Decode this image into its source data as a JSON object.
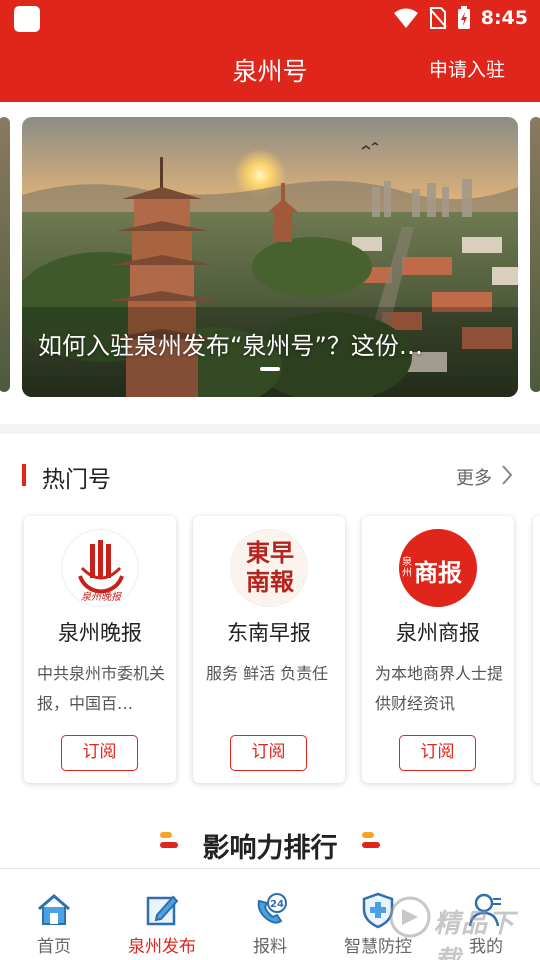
{
  "status_bar": {
    "time": "8:45"
  },
  "header": {
    "title": "泉州号",
    "apply_label": "申请入驻"
  },
  "banner": {
    "caption": "如何入驻泉州发布“泉州号”？这份…"
  },
  "hot_section": {
    "title": "热门号",
    "more_label": "更多",
    "cards": [
      {
        "name": "泉州晚报",
        "logo_text": "泉州晚报",
        "desc": "中共泉州市委机关报，中国百…",
        "subscribe_label": "订阅"
      },
      {
        "name": "东南早报",
        "logo_text": "東早南報",
        "desc": "服务 鲜活 负责任",
        "subscribe_label": "订阅"
      },
      {
        "name": "泉州商报",
        "logo_text_small": "泉州",
        "logo_text": "商报",
        "desc": "为本地商界人士提供财经资讯",
        "subscribe_label": "订阅"
      }
    ]
  },
  "ranking": {
    "title": "影响力排行"
  },
  "tabbar": {
    "tabs": [
      {
        "label": "首页",
        "icon": "home-icon"
      },
      {
        "label": "泉州发布",
        "icon": "edit-icon"
      },
      {
        "label": "报料",
        "icon": "phone-24-icon"
      },
      {
        "label": "智慧防控",
        "icon": "shield-plus-icon"
      },
      {
        "label": "我的",
        "icon": "user-icon"
      }
    ],
    "active_tab": "泉州发布",
    "watermark": "精品下载"
  },
  "colors": {
    "brand_red": "#e0251b",
    "accent_orange": "#f5a623",
    "tab_icon_blue": "#3a86c8"
  }
}
